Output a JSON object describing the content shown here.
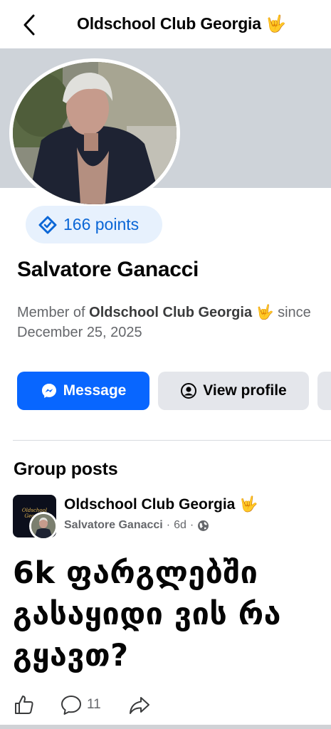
{
  "header": {
    "title": "Oldschool Club Georgia 🤟",
    "back_icon": "chevron-left-icon"
  },
  "profile": {
    "points": "166 points",
    "points_icon": "diamond-badge-icon",
    "name": "Salvatore Ganacci",
    "member_prefix": "Member of ",
    "member_group": "Oldschool Club Georgia 🤟",
    "member_suffix": " since",
    "member_date": "December 25, 2025"
  },
  "buttons": {
    "message": "Message",
    "message_icon": "messenger-icon",
    "view_profile": "View profile",
    "view_profile_icon": "user-circle-icon"
  },
  "posts_section": {
    "title": "Group posts"
  },
  "post": {
    "group": "Oldschool Club Georgia 🤟",
    "group_thumb_text": "Oldschool Georgia",
    "author": "Salvatore Ganacci",
    "time": "6d",
    "privacy_icon": "globe-icon",
    "text": "6k ფარგლებში გასაყიდი ვის რა გყავთ?",
    "comment_count": "11",
    "actions": [
      "like-icon",
      "comment-icon",
      "share-icon"
    ]
  },
  "colors": {
    "accent": "#0866ff",
    "points_bg": "#e7f1fd",
    "points_text": "#0a66d6",
    "cover": "#ced3d9",
    "secondary_text": "#65676b"
  }
}
